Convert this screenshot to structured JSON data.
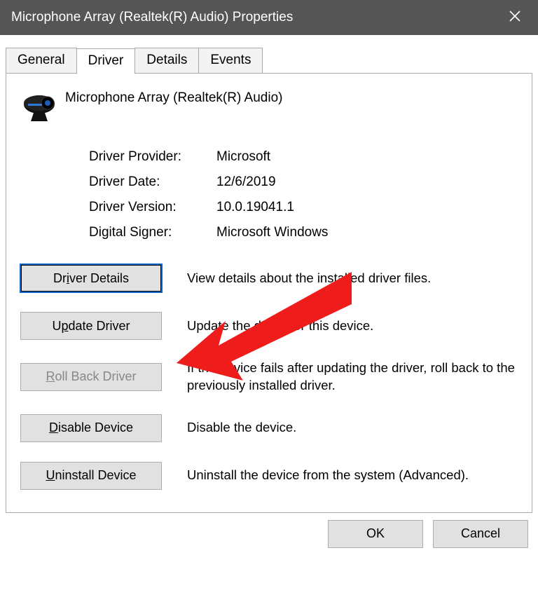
{
  "window": {
    "title": "Microphone Array (Realtek(R) Audio) Properties"
  },
  "tabs": [
    {
      "label": "General"
    },
    {
      "label": "Driver"
    },
    {
      "label": "Details"
    },
    {
      "label": "Events"
    }
  ],
  "active_tab_index": 1,
  "device": {
    "name": "Microphone Array (Realtek(R) Audio)"
  },
  "info": {
    "provider_label": "Driver Provider:",
    "provider_value": "Microsoft",
    "date_label": "Driver Date:",
    "date_value": "12/6/2019",
    "version_label": "Driver Version:",
    "version_value": "10.0.19041.1",
    "signer_label": "Digital Signer:",
    "signer_value": "Microsoft Windows"
  },
  "actions": {
    "details": {
      "label_pre": "Dr",
      "label_u": "i",
      "label_post": "ver Details",
      "desc": "View details about the installed driver files."
    },
    "update": {
      "label_pre": "U",
      "label_u": "p",
      "label_post": "date Driver",
      "desc": "Update the driver for this device."
    },
    "rollback": {
      "label_pre": "",
      "label_u": "R",
      "label_post": "oll Back Driver",
      "desc": "If the device fails after updating the driver, roll back to the previously installed driver."
    },
    "disable": {
      "label_pre": "",
      "label_u": "D",
      "label_post": "isable Device",
      "desc": "Disable the device."
    },
    "uninstall": {
      "label_pre": "",
      "label_u": "U",
      "label_post": "ninstall Device",
      "desc": "Uninstall the device from the system (Advanced)."
    }
  },
  "dialog_buttons": {
    "ok": "OK",
    "cancel": "Cancel"
  }
}
